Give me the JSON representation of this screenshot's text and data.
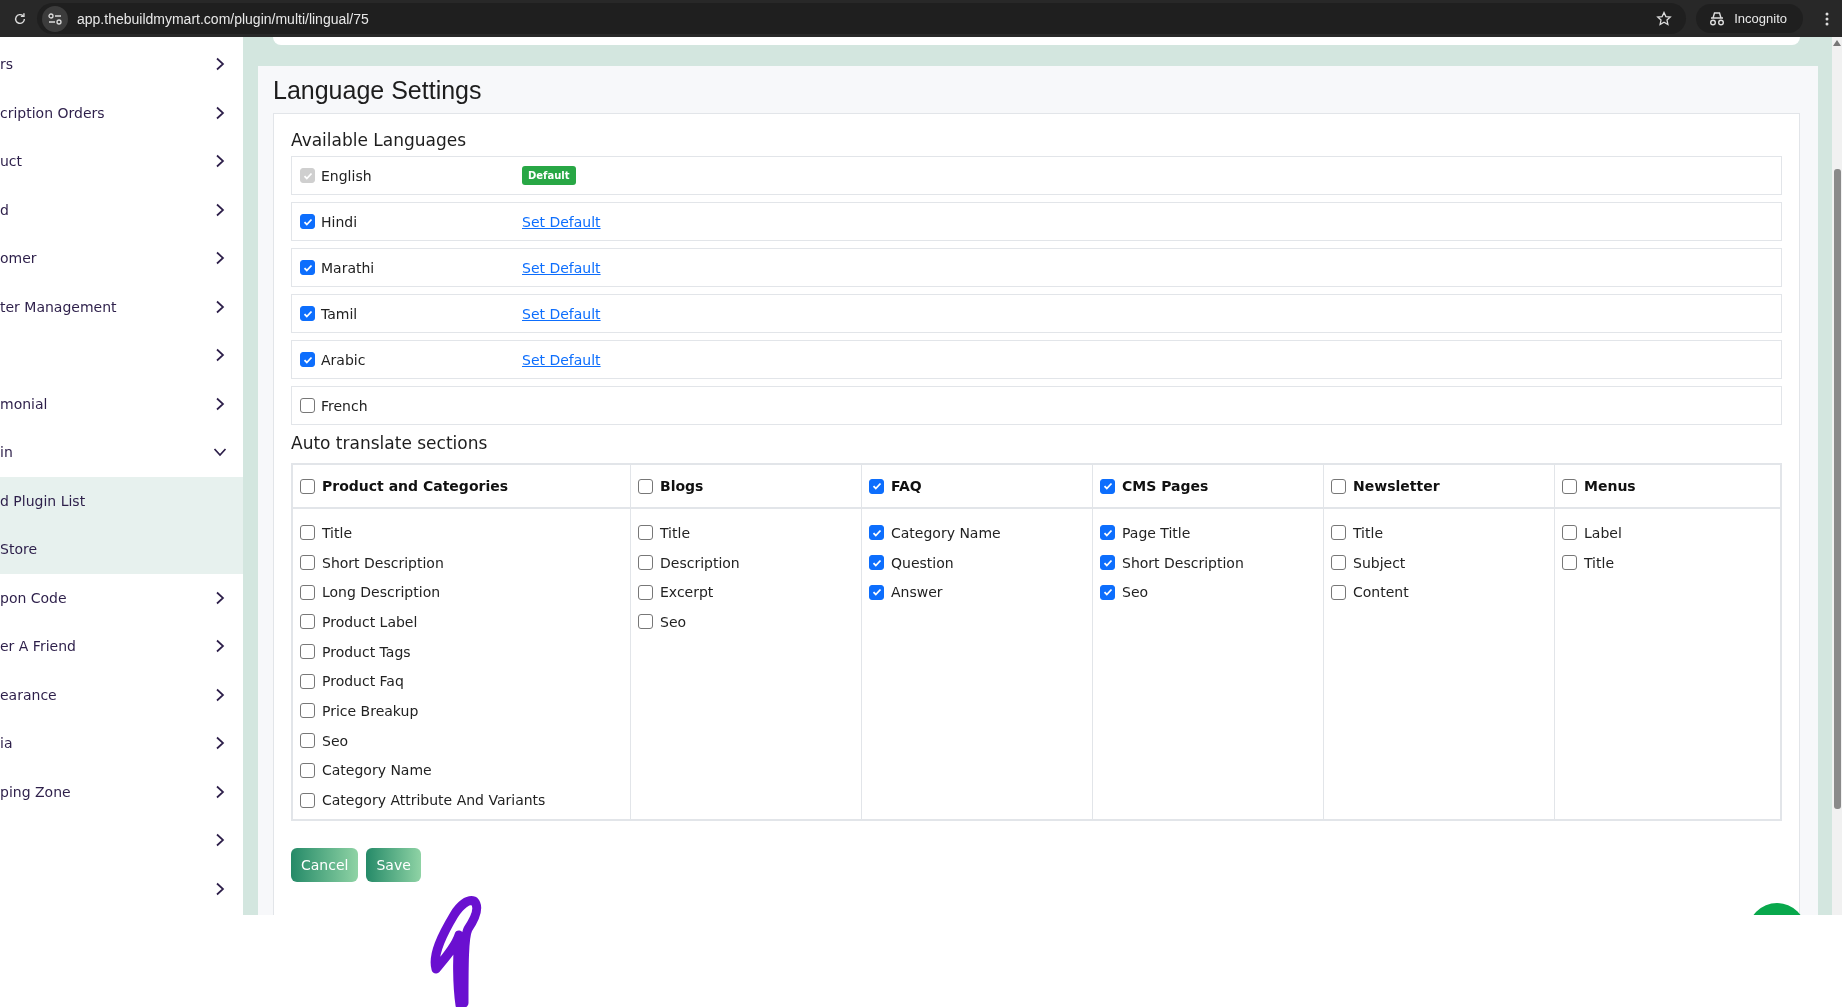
{
  "browser": {
    "url": "app.thebuildmymart.com/plugin/multi/lingual/75",
    "profile": "Incognito"
  },
  "sidebar": {
    "items": [
      {
        "label": "rs",
        "expanded": false
      },
      {
        "label": "cription Orders",
        "expanded": false
      },
      {
        "label": "uct",
        "expanded": false
      },
      {
        "label": "d",
        "expanded": false
      },
      {
        "label": "omer",
        "expanded": false
      },
      {
        "label": "ter Management",
        "expanded": false
      },
      {
        "expanded": false
      },
      {
        "label": "monial",
        "expanded": false
      },
      {
        "label": "in",
        "expanded": true,
        "children": [
          {
            "label": "d Plugin List"
          },
          {
            "label": "Store"
          }
        ]
      },
      {
        "label": "pon Code",
        "expanded": false
      },
      {
        "label": "er A Friend",
        "expanded": false
      },
      {
        "label": "earance",
        "expanded": false
      },
      {
        "label": "ia",
        "expanded": false
      },
      {
        "label": "ping Zone",
        "expanded": false
      },
      {
        "expanded": false
      },
      {
        "expanded": false
      }
    ]
  },
  "page": {
    "title": "Language Settings"
  },
  "languages": {
    "title": "Available Languages",
    "items": [
      {
        "name": "English",
        "checked": true,
        "disabled": true,
        "action": {
          "kind": "badge",
          "label": "Default"
        }
      },
      {
        "name": "Hindi",
        "checked": true,
        "disabled": false,
        "action": {
          "kind": "link",
          "label": "Set Default"
        }
      },
      {
        "name": "Marathi",
        "checked": true,
        "disabled": false,
        "action": {
          "kind": "link",
          "label": "Set Default"
        }
      },
      {
        "name": "Tamil",
        "checked": true,
        "disabled": false,
        "action": {
          "kind": "link",
          "label": "Set Default"
        }
      },
      {
        "name": "Arabic",
        "checked": true,
        "disabled": false,
        "action": {
          "kind": "link",
          "label": "Set Default"
        }
      },
      {
        "name": "French",
        "checked": false,
        "disabled": false
      }
    ]
  },
  "auto_translate": {
    "title": "Auto translate sections",
    "sections": [
      {
        "title": "Product and Categories",
        "checked": false,
        "fields": [
          {
            "label": "Title",
            "checked": false
          },
          {
            "label": "Short Description",
            "checked": false
          },
          {
            "label": "Long Description",
            "checked": false
          },
          {
            "label": "Product Label",
            "checked": false
          },
          {
            "label": "Product Tags",
            "checked": false
          },
          {
            "label": "Product Faq",
            "checked": false
          },
          {
            "label": "Price Breakup",
            "checked": false
          },
          {
            "label": "Seo",
            "checked": false
          },
          {
            "label": "Category Name",
            "checked": false
          },
          {
            "label": "Category Attribute And Variants",
            "checked": false
          }
        ]
      },
      {
        "title": "Blogs",
        "checked": false,
        "fields": [
          {
            "label": "Title",
            "checked": false
          },
          {
            "label": "Description",
            "checked": false
          },
          {
            "label": "Excerpt",
            "checked": false
          },
          {
            "label": "Seo",
            "checked": false
          }
        ]
      },
      {
        "title": "FAQ",
        "checked": true,
        "fields": [
          {
            "label": "Category Name",
            "checked": true
          },
          {
            "label": "Question",
            "checked": true
          },
          {
            "label": "Answer",
            "checked": true
          }
        ]
      },
      {
        "title": "CMS Pages",
        "checked": true,
        "fields": [
          {
            "label": "Page Title",
            "checked": true
          },
          {
            "label": "Short Description",
            "checked": true
          },
          {
            "label": "Seo",
            "checked": true
          }
        ]
      },
      {
        "title": "Newsletter",
        "checked": false,
        "fields": [
          {
            "label": "Title",
            "checked": false
          },
          {
            "label": "Subject",
            "checked": false
          },
          {
            "label": "Content",
            "checked": false
          }
        ]
      },
      {
        "title": "Menus",
        "checked": false,
        "fields": [
          {
            "label": "Label",
            "checked": false
          },
          {
            "label": "Title",
            "checked": false
          }
        ]
      }
    ]
  },
  "buttons": [
    {
      "label": "Cancel"
    },
    {
      "label": "Save"
    }
  ]
}
